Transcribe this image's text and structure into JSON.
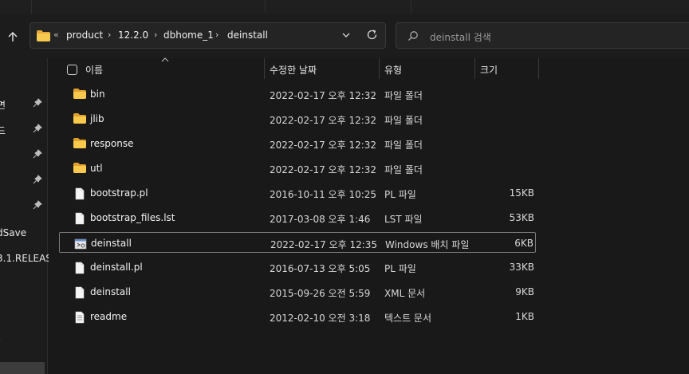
{
  "address": {
    "overflow": "«",
    "crumbs": [
      "product",
      "12.2.0",
      "dbhome_1",
      "deinstall"
    ]
  },
  "search": {
    "placeholder": "deinstall 검색"
  },
  "sidebar": {
    "items": [
      {
        "label": "면",
        "pinned": true
      },
      {
        "label": "드",
        "pinned": true
      },
      {
        "label": "",
        "pinned": true
      },
      {
        "label": "",
        "pinned": true
      },
      {
        "label": "",
        "pinned": true
      },
      {
        "label": "dSave",
        "pinned": false
      },
      {
        "label": "3.1.RELEAS",
        "pinned": false
      }
    ]
  },
  "columns": {
    "name": "이름",
    "date": "수정한 날짜",
    "type": "유형",
    "size": "크기"
  },
  "files": [
    {
      "name": "bin",
      "date": "2022-02-17 오후 12:32",
      "type": "파일 폴더",
      "size": "",
      "icon": "folder-icon"
    },
    {
      "name": "jlib",
      "date": "2022-02-17 오후 12:32",
      "type": "파일 폴더",
      "size": "",
      "icon": "folder-icon"
    },
    {
      "name": "response",
      "date": "2022-02-17 오후 12:32",
      "type": "파일 폴더",
      "size": "",
      "icon": "folder-icon"
    },
    {
      "name": "utl",
      "date": "2022-02-17 오후 12:32",
      "type": "파일 폴더",
      "size": "",
      "icon": "folder-icon"
    },
    {
      "name": "bootstrap.pl",
      "date": "2016-10-11 오후 10:25",
      "type": "PL 파일",
      "size": "15KB",
      "icon": "file-icon"
    },
    {
      "name": "bootstrap_files.lst",
      "date": "2017-03-08 오후 1:46",
      "type": "LST 파일",
      "size": "53KB",
      "icon": "file-icon"
    },
    {
      "name": "deinstall",
      "date": "2022-02-17 오후 12:35",
      "type": "Windows 배치 파일",
      "size": "6KB",
      "icon": "batch-file-icon",
      "selected": true
    },
    {
      "name": "deinstall.pl",
      "date": "2016-07-13 오후 5:05",
      "type": "PL 파일",
      "size": "33KB",
      "icon": "file-icon"
    },
    {
      "name": "deinstall",
      "date": "2015-09-26 오전 5:59",
      "type": "XML 문서",
      "size": "9KB",
      "icon": "file-icon"
    },
    {
      "name": "readme",
      "date": "2012-02-10 오전 3:18",
      "type": "텍스트 문서",
      "size": "1KB",
      "icon": "text-file-icon"
    }
  ]
}
